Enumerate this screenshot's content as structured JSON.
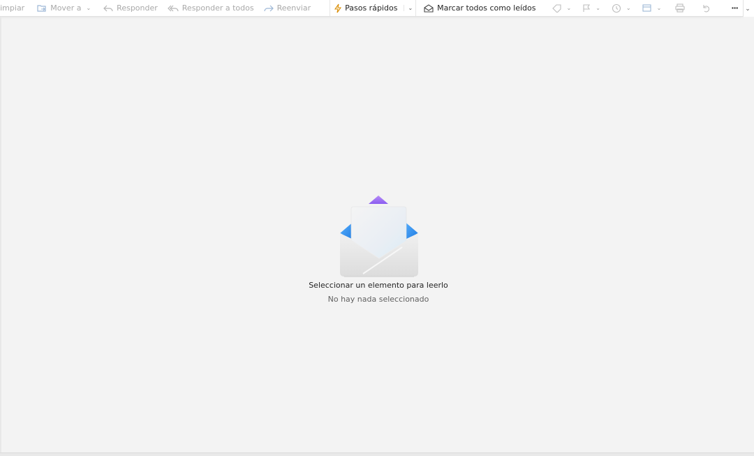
{
  "toolbar": {
    "items": [
      {
        "label": "Limpiar",
        "icon": "broom-icon"
      },
      {
        "label": "Mover a",
        "icon": "move-folder-icon"
      },
      {
        "label": "Responder",
        "icon": "reply-icon"
      },
      {
        "label": "Responder a todos",
        "icon": "reply-all-icon"
      },
      {
        "label": "Reenviar",
        "icon": "forward-icon"
      },
      {
        "label": "Pasos rápidos",
        "icon": "lightning-icon"
      },
      {
        "label": "Marcar todos como leídos",
        "icon": "envelope-open-icon"
      }
    ],
    "more_label": "···"
  },
  "empty_state": {
    "title": "Seleccionar un elemento para leerlo",
    "subtitle": "No hay nada seleccionado"
  },
  "colors": {
    "accent": "#0f6cbd",
    "envelope_blue": "#2f8df0",
    "envelope_purple": "#9b6cf5"
  }
}
